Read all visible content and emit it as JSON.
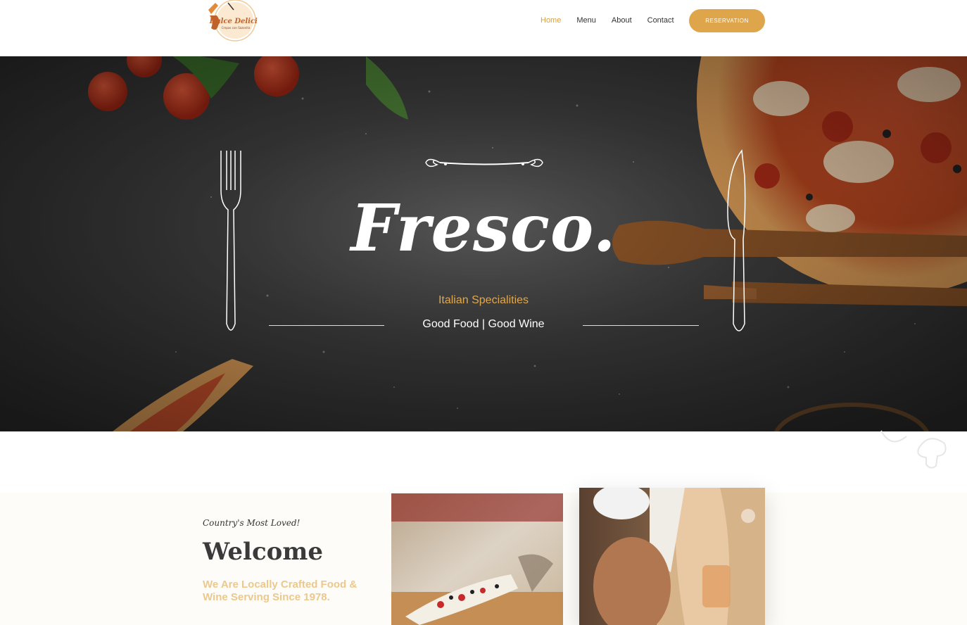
{
  "header": {
    "logo_text": "Dulce Delicia",
    "logo_subtext": "Crepas con Sazonita",
    "nav": [
      {
        "label": "Home",
        "active": true
      },
      {
        "label": "Menu",
        "active": false
      },
      {
        "label": "About",
        "active": false
      },
      {
        "label": "Contact",
        "active": false
      }
    ],
    "reservation_label": "RESERVATION"
  },
  "hero": {
    "title": "Fresco.",
    "subtitle": "Italian Specialities",
    "tagline": "Good Food | Good Wine"
  },
  "welcome": {
    "kicker": "Country's Most Loved!",
    "title": "Welcome",
    "subtitle": "We Are Locally Crafted Food & Wine Serving Since 1978."
  },
  "colors": {
    "accent": "#dea54b",
    "nav_active": "#d9a040",
    "hero_dark": "#3d3d3d",
    "subtitle_gold": "#e0a84f",
    "welcome_sub": "#ecc88c"
  }
}
